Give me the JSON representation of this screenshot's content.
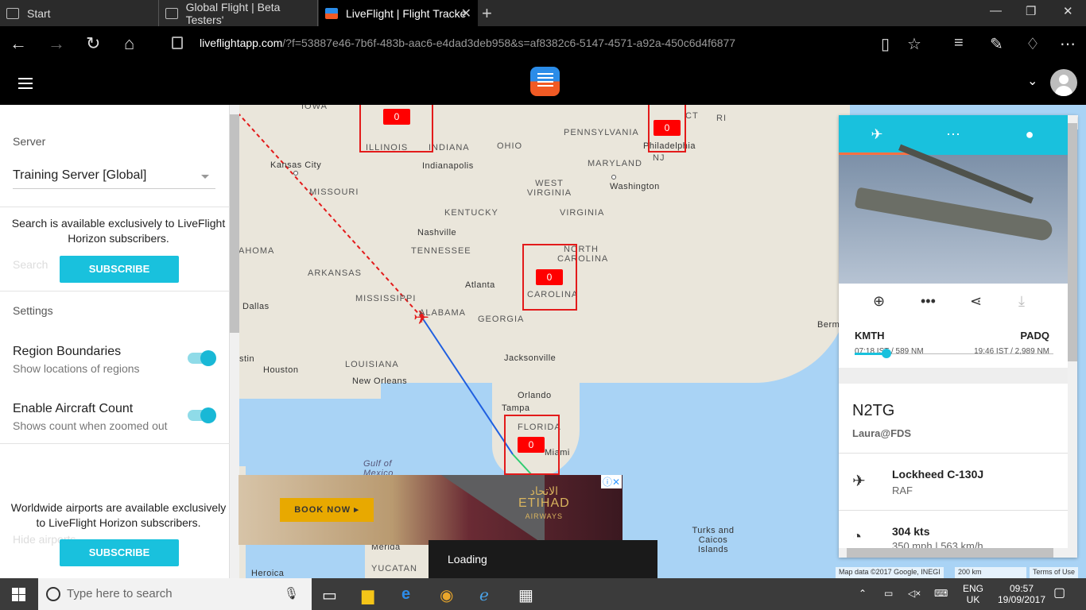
{
  "browser": {
    "tabs": [
      {
        "label": "Start"
      },
      {
        "label": "Global Flight | Beta Testers'"
      },
      {
        "label": "LiveFlight | Flight Tracke"
      }
    ],
    "url_host": "liveflightapp.com",
    "url_path": "/?f=53887e46-7b6f-483b-aac6-e4dad3deb958&s=af8382c6-5147-4571-a92a-450c6d4f6877"
  },
  "panel": {
    "server_heading": "Server",
    "server_value": "Training Server [Global]",
    "search_note": "Search is available exclusively to LiveFlight Horizon subscribers.",
    "search_placeholder": "Search",
    "subscribe_label": "SUBSCRIBE",
    "settings_heading": "Settings",
    "region_title": "Region Boundaries",
    "region_sub": "Show locations of regions",
    "count_title": "Enable Aircraft Count",
    "count_sub": "Shows count when zoomed out",
    "airports_note": "Worldwide airports are available exclusively to LiveFlight Horizon subscribers.",
    "airports_ghost": "Hide airports"
  },
  "map": {
    "labels": {
      "iowa": "IOWA",
      "illinois": "ILLINOIS",
      "indiana": "INDIANA",
      "ohio": "OHIO",
      "pennsylvania": "PENNSYLVANIA",
      "ct": "CT",
      "ri": "RI",
      "nj": "NJ",
      "philadelphia": "Philadelphia",
      "kansas_city": "Kansas City",
      "indianapolis": "Indianapolis",
      "missouri": "MISSOURI",
      "maryland": "MARYLAND",
      "washington": "Washington",
      "west_virginia": "WEST VIRGINIA",
      "kentucky": "KENTUCKY",
      "virginia": "VIRGINIA",
      "nashville": "Nashville",
      "tennessee": "TENNESSEE",
      "north_carolina": "NORTH CAROLINA",
      "oklahoma": "AHOMA",
      "arkansas": "ARKANSAS",
      "atlanta": "Atlanta",
      "mississippi": "MISSISSIPPI",
      "alabama": "ALABAMA",
      "georgia": "GEORGIA",
      "south_carolina": "CAROLINA",
      "dallas": "Dallas",
      "louisiana": "LOUISIANA",
      "jacksonville": "Jacksonville",
      "houston": "Houston",
      "new_orleans": "New Orleans",
      "orlando": "Orlando",
      "tampa": "Tampa",
      "florida": "FLORIDA",
      "miami": "Miami",
      "gulf": "Gulf of Mexico",
      "bermuda": "Bermu",
      "turks": "Turks and Caicos Islands",
      "merida": "Mérida",
      "yucatan": "YUCATAN",
      "heroica": "Heroica",
      "texas": "stin"
    },
    "region_counts": [
      "0",
      "0",
      "0",
      "0"
    ],
    "attribution": "Map data ©2017 Google, INEGI",
    "scale": "200 km",
    "terms": "Terms of Use"
  },
  "ad": {
    "book_label": "BOOK NOW ▸",
    "brand_ar": "الاتحاد",
    "brand": "ETIHAD",
    "brand_sub": "AIRWAYS"
  },
  "loading_text": "Loading",
  "flight": {
    "origin": "KMTH",
    "destination": "PADQ",
    "origin_info": "07:18 IST / 589 NM",
    "dest_info": "19:46 IST / 2,989 NM",
    "progress": 0.16,
    "callsign": "N2TG",
    "pilot": "Laura@FDS",
    "aircraft": "Lockheed C-130J",
    "livery": "RAF",
    "speed": "304 kts",
    "speed_sub": "350 mph | 563 km/h"
  },
  "taskbar": {
    "search_placeholder": "Type here to search",
    "lang": "ENG",
    "region": "UK",
    "time": "09:57",
    "date": "19/09/2017"
  }
}
